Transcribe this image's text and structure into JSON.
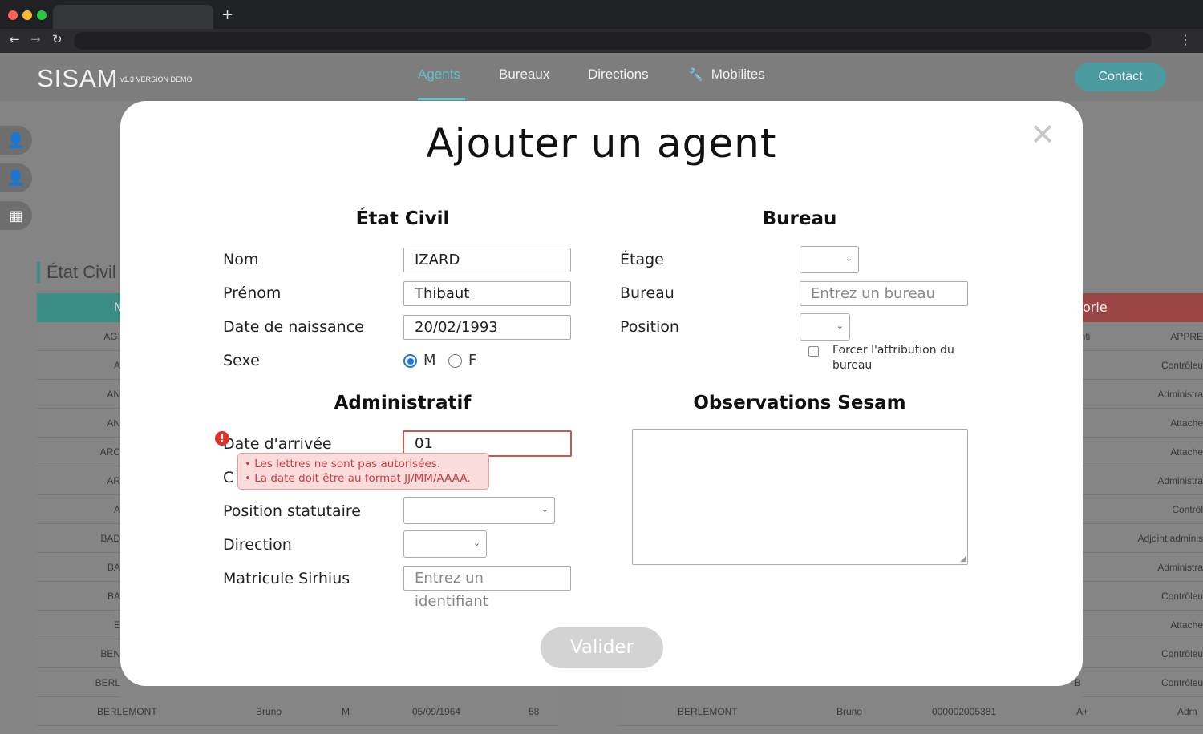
{
  "app": {
    "name": "SISAM",
    "version": "v1.3 VERSION DEMO",
    "nav": [
      "Agents",
      "Bureaux",
      "Directions",
      "Mobilites"
    ],
    "active_nav": "Agents",
    "contact_label": "Contact"
  },
  "background": {
    "section_title": "État Civil",
    "left_header_fragment": "N",
    "right_header_fragment": "orie",
    "left_rows": [
      "AGI",
      "A",
      "AN",
      "AN",
      "ARC",
      "AR",
      "A",
      "BAD",
      "BA",
      "BA",
      "E",
      "BEN",
      "BERL"
    ],
    "right_rows": [
      {
        "mid": "enti",
        "right": "APPRE"
      },
      {
        "mid": "",
        "right": "Contrôleu"
      },
      {
        "mid": "",
        "right": "Administra"
      },
      {
        "mid": "",
        "right": "Attache"
      },
      {
        "mid": "",
        "right": "Attache"
      },
      {
        "mid": "",
        "right": "Administra"
      },
      {
        "mid": "",
        "right": "Contrôl"
      },
      {
        "mid": "",
        "right": "Adjoint adminis"
      },
      {
        "mid": "",
        "right": "Administra"
      },
      {
        "mid": "",
        "right": "Contrôleu"
      },
      {
        "mid": "",
        "right": "Attache"
      },
      {
        "mid": "",
        "right": "Contrôleu"
      },
      {
        "mid": "B",
        "right": "Contrôleu"
      }
    ],
    "last_row_left": {
      "nom": "BERLEMONT",
      "prenom": "Bruno",
      "sexe": "M",
      "date": "05/09/1964",
      "age": "58"
    },
    "last_row_right": {
      "nom": "BERLEMONT",
      "prenom": "Bruno",
      "matricule": "000002005381",
      "cat": "A+",
      "grade": "Adm"
    }
  },
  "modal": {
    "title": "Ajouter un agent",
    "etat_civil": {
      "title": "État Civil",
      "nom_label": "Nom",
      "nom_value": "IZARD",
      "prenom_label": "Prénom",
      "prenom_value": "Thibaut",
      "naissance_label": "Date de naissance",
      "naissance_value": "20/02/1993",
      "sexe_label": "Sexe",
      "sexe_m": "M",
      "sexe_f": "F",
      "sexe_selected": "M"
    },
    "bureau": {
      "title": "Bureau",
      "etage_label": "Étage",
      "bureau_label": "Bureau",
      "bureau_placeholder": "Entrez un bureau",
      "position_label": "Position",
      "force_label": "Forcer l'attribution du bureau"
    },
    "administratif": {
      "title": "Administratif",
      "arrivee_label": "Date d'arrivée",
      "arrivee_value": "01",
      "hidden_label_fragment": "C",
      "position_statutaire_label": "Position statutaire",
      "direction_label": "Direction",
      "matricule_label": "Matricule Sirhius",
      "matricule_placeholder": "Entrez un identifiant"
    },
    "observations": {
      "title": "Observations Sesam"
    },
    "errors": [
      "• Les lettres ne sont pas autorisées.",
      "• La date doit être au format JJ/MM/AAAA."
    ],
    "submit_label": "Valider"
  },
  "colors": {
    "accent": "#62c1c9",
    "error": "#cc3d3d",
    "submit_disabled": "#d3d3d3"
  }
}
